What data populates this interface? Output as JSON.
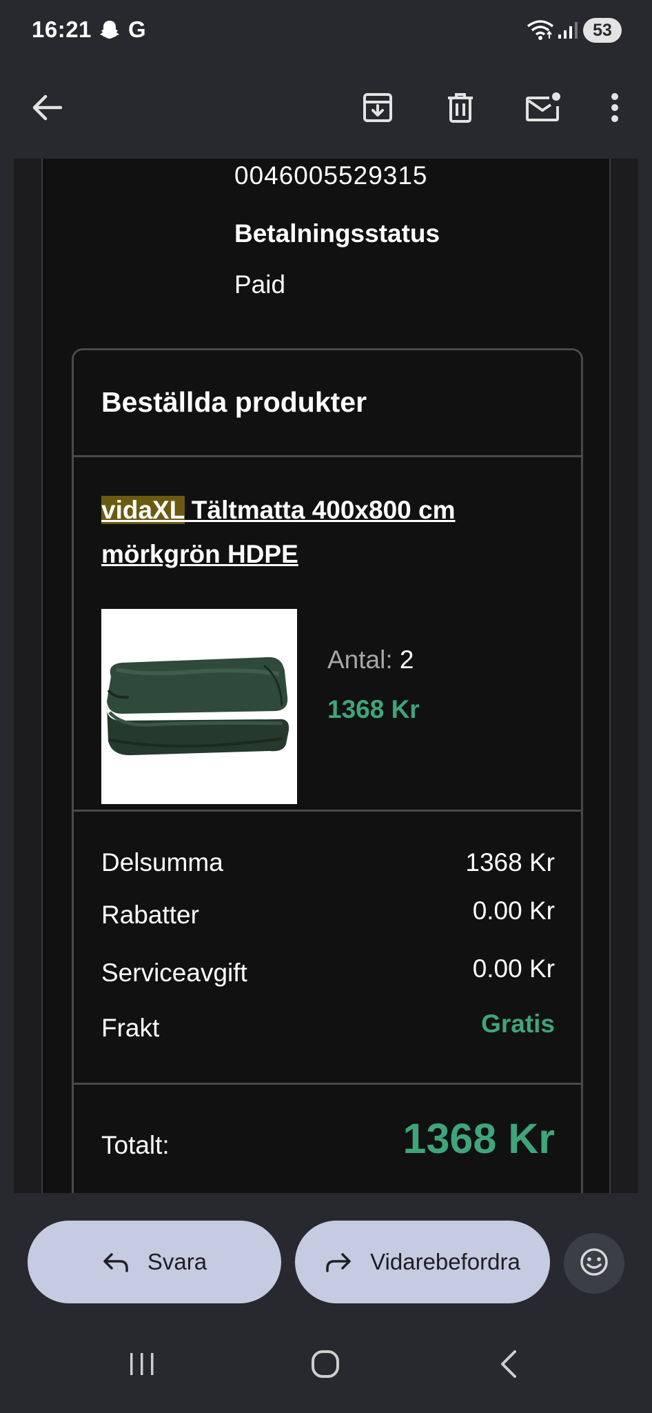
{
  "status_bar": {
    "time": "16:21",
    "carrier_letter": "G",
    "battery": "53"
  },
  "app_bar": {
    "icons": [
      "arrow-back-icon",
      "archive-icon",
      "trash-icon",
      "mail-unread-icon",
      "more-vert-icon"
    ]
  },
  "order": {
    "tracking_number": "0046005529315",
    "payment_status_label": "Betalningsstatus",
    "payment_status_value": "Paid",
    "products_title": "Beställda produkter",
    "product": {
      "brand": "vidaXL",
      "name": " Tältmatta 400x800 cm mörkgrön HDPE",
      "quantity_label": "Antal:",
      "quantity_value": "2",
      "price": "1368 Kr"
    },
    "summary": [
      {
        "label": "Delsumma",
        "value": "1368 Kr"
      },
      {
        "label": "Rabatter",
        "value": "0.00 Kr"
      },
      {
        "label": "Serviceavgift",
        "value": "0.00 Kr"
      },
      {
        "label": "Frakt",
        "value": "Gratis"
      }
    ],
    "total_label": "Totalt:",
    "total_value": "1368 Kr"
  },
  "actions": {
    "reply_label": "Svara",
    "forward_label": "Vidarebefordra"
  },
  "colors": {
    "accent_green": "#3fa57a",
    "pill_bg": "#c5cbe0",
    "brand_highlight": "#6b5a12"
  }
}
